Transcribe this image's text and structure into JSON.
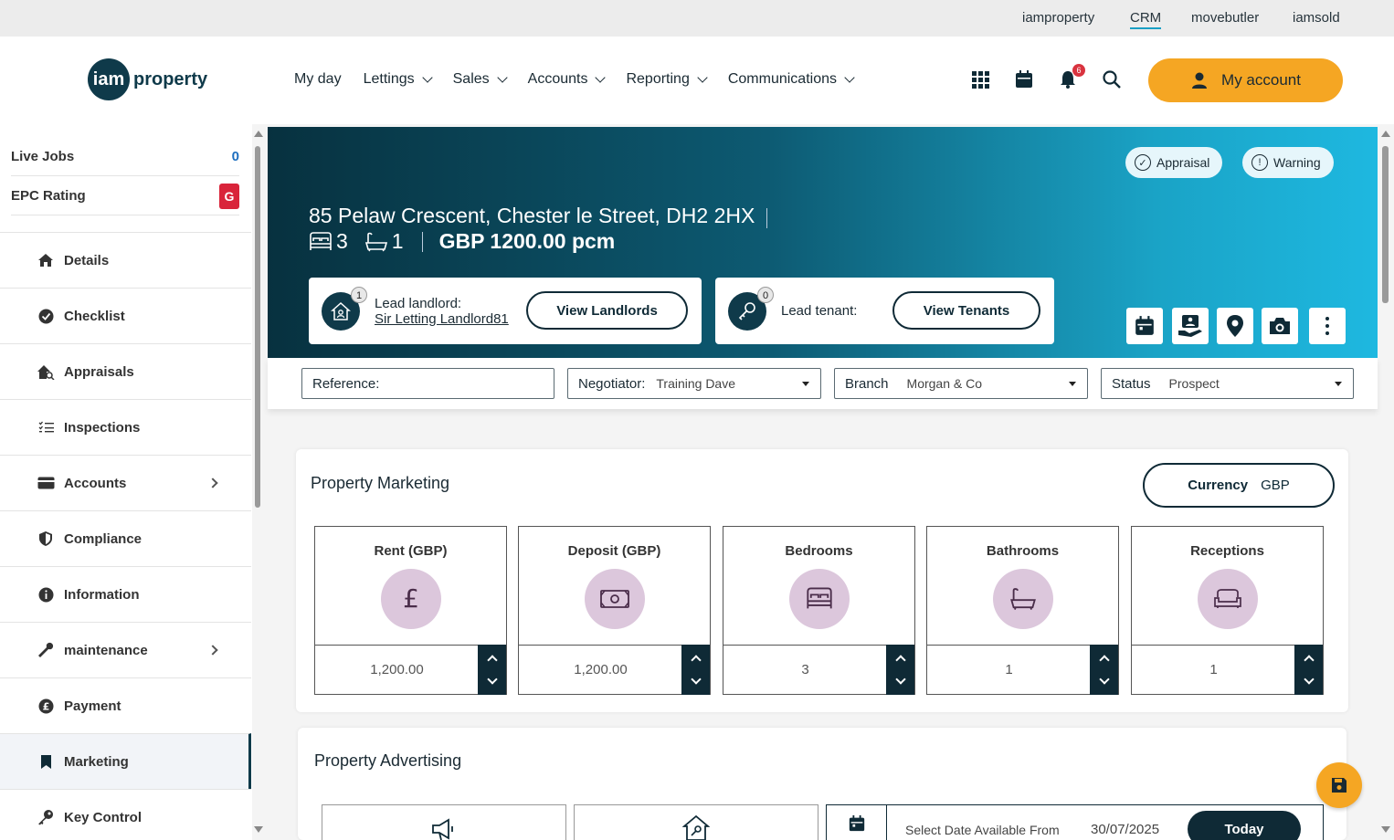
{
  "topnav": {
    "links": [
      "iamproperty",
      "CRM",
      "movebutler",
      "iamsold"
    ],
    "active": "CRM"
  },
  "header": {
    "logo_mark": "iam",
    "logo_text": "property",
    "nav": [
      {
        "label": "My day",
        "dropdown": false
      },
      {
        "label": "Lettings",
        "dropdown": true
      },
      {
        "label": "Sales",
        "dropdown": true
      },
      {
        "label": "Accounts",
        "dropdown": true
      },
      {
        "label": "Reporting",
        "dropdown": true
      },
      {
        "label": "Communications",
        "dropdown": true
      }
    ],
    "icons": [
      "apps-grid-icon",
      "calendar-icon",
      "bell-icon",
      "search-icon"
    ],
    "notification_count": "6",
    "my_account_label": "My account",
    "accent_color": "#f5a623"
  },
  "sidebar": {
    "stats": [
      {
        "label": "Live Jobs",
        "value": "0"
      },
      {
        "label": "EPC Rating",
        "value": "G"
      }
    ],
    "items": [
      {
        "label": "Details",
        "icon": "home-icon",
        "has_submenu": false
      },
      {
        "label": "Checklist",
        "icon": "check-circle-icon",
        "has_submenu": false
      },
      {
        "label": "Appraisals",
        "icon": "home-search-icon",
        "has_submenu": false
      },
      {
        "label": "Inspections",
        "icon": "list-check-icon",
        "has_submenu": false
      },
      {
        "label": "Accounts",
        "icon": "credit-card-icon",
        "has_submenu": true
      },
      {
        "label": "Compliance",
        "icon": "shield-icon",
        "has_submenu": false
      },
      {
        "label": "Information",
        "icon": "info-icon",
        "has_submenu": false
      },
      {
        "label": "maintenance",
        "icon": "wrench-icon",
        "has_submenu": true
      },
      {
        "label": "Payment",
        "icon": "pound-coin-icon",
        "has_submenu": false
      },
      {
        "label": "Marketing",
        "icon": "bookmark-icon",
        "has_submenu": false,
        "active": true
      },
      {
        "label": "Key Control",
        "icon": "key-icon",
        "has_submenu": false
      }
    ]
  },
  "hero": {
    "tags": [
      "Appraisal",
      "Warning"
    ],
    "address": "85 Pelaw Crescent, Chester le Street, DH2 2HX",
    "bedrooms": "3",
    "bathrooms": "1",
    "price": "GBP 1200.00 pcm",
    "landlord": {
      "count": "1",
      "label": "Lead landlord:",
      "name": "Sir Letting Landlord81",
      "button": "View Landlords"
    },
    "tenant": {
      "count": "0",
      "label": "Lead tenant:",
      "button": "View Tenants"
    },
    "actions": [
      "calendar-icon",
      "hand-home-icon",
      "map-pin-icon",
      "camera-icon",
      "more-vertical-icon"
    ]
  },
  "fields": {
    "reference_label": "Reference:",
    "reference_value": "",
    "negotiator_label": "Negotiator:",
    "negotiator_value": "Training Dave",
    "branch_label": "Branch",
    "branch_value": "Morgan & Co",
    "status_label": "Status",
    "status_value": "Prospect"
  },
  "marketing": {
    "title": "Property Marketing",
    "currency_label": "Currency",
    "currency_value": "GBP",
    "tiles": [
      {
        "label": "Rent (GBP)",
        "icon": "pound-icon",
        "value": "1,200.00"
      },
      {
        "label": "Deposit (GBP)",
        "icon": "banknote-icon",
        "value": "1,200.00"
      },
      {
        "label": "Bedrooms",
        "icon": "bed-icon",
        "value": "3"
      },
      {
        "label": "Bathrooms",
        "icon": "bath-icon",
        "value": "1"
      },
      {
        "label": "Receptions",
        "icon": "sofa-icon",
        "value": "1"
      }
    ]
  },
  "advertising": {
    "title": "Property Advertising",
    "date_label": "Select Date Available From",
    "date_value": "30/07/2025",
    "today_button": "Today"
  }
}
